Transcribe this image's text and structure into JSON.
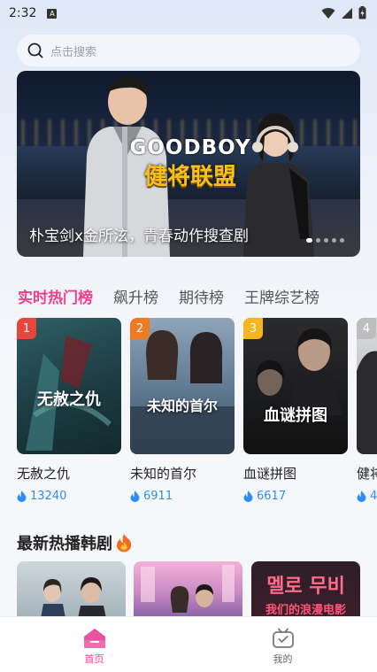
{
  "status_bar": {
    "time": "2:32",
    "notif_letter": "A"
  },
  "search": {
    "placeholder": "点击搜索"
  },
  "banner": {
    "logo_en": "GOODBOY",
    "logo_cn": "健将联盟",
    "caption": "朴宝剑x金所泫，青春动作搜查剧",
    "dot_count": 5,
    "active_dot": 0
  },
  "tabs": [
    {
      "label": "实时热门榜",
      "active": true
    },
    {
      "label": "飙升榜",
      "active": false
    },
    {
      "label": "期待榜",
      "active": false
    },
    {
      "label": "王牌综艺榜",
      "active": false
    }
  ],
  "rank_items": [
    {
      "rank": "1",
      "title": "无赦之仇",
      "heat": "13240",
      "poster_text": "无赦之仇",
      "badge_color": "#e8453c"
    },
    {
      "rank": "2",
      "title": "未知的首尔",
      "heat": "6911",
      "poster_text": "未知的首尔",
      "badge_color": "#f07a22"
    },
    {
      "rank": "3",
      "title": "血谜拼图",
      "heat": "6617",
      "poster_text": "血谜拼图",
      "badge_color": "#f5b51c"
    },
    {
      "rank": "4",
      "title": "健将",
      "heat": "4",
      "poster_text": "",
      "badge_color": "#bdbdbd"
    }
  ],
  "section": {
    "title": "最新热播韩剧",
    "icon": "fire-icon"
  },
  "latest_items": [
    {
      "poster_text": ""
    },
    {
      "poster_text": ""
    },
    {
      "poster_text": "멜로 무비",
      "poster_text2": "我们的浪漫电影"
    }
  ],
  "bottom_nav": [
    {
      "label": "首页",
      "active": true
    },
    {
      "label": "我的",
      "active": false
    }
  ],
  "colors": {
    "accent": "#ee3f8c",
    "heat_blue": "#2b8ef0"
  }
}
